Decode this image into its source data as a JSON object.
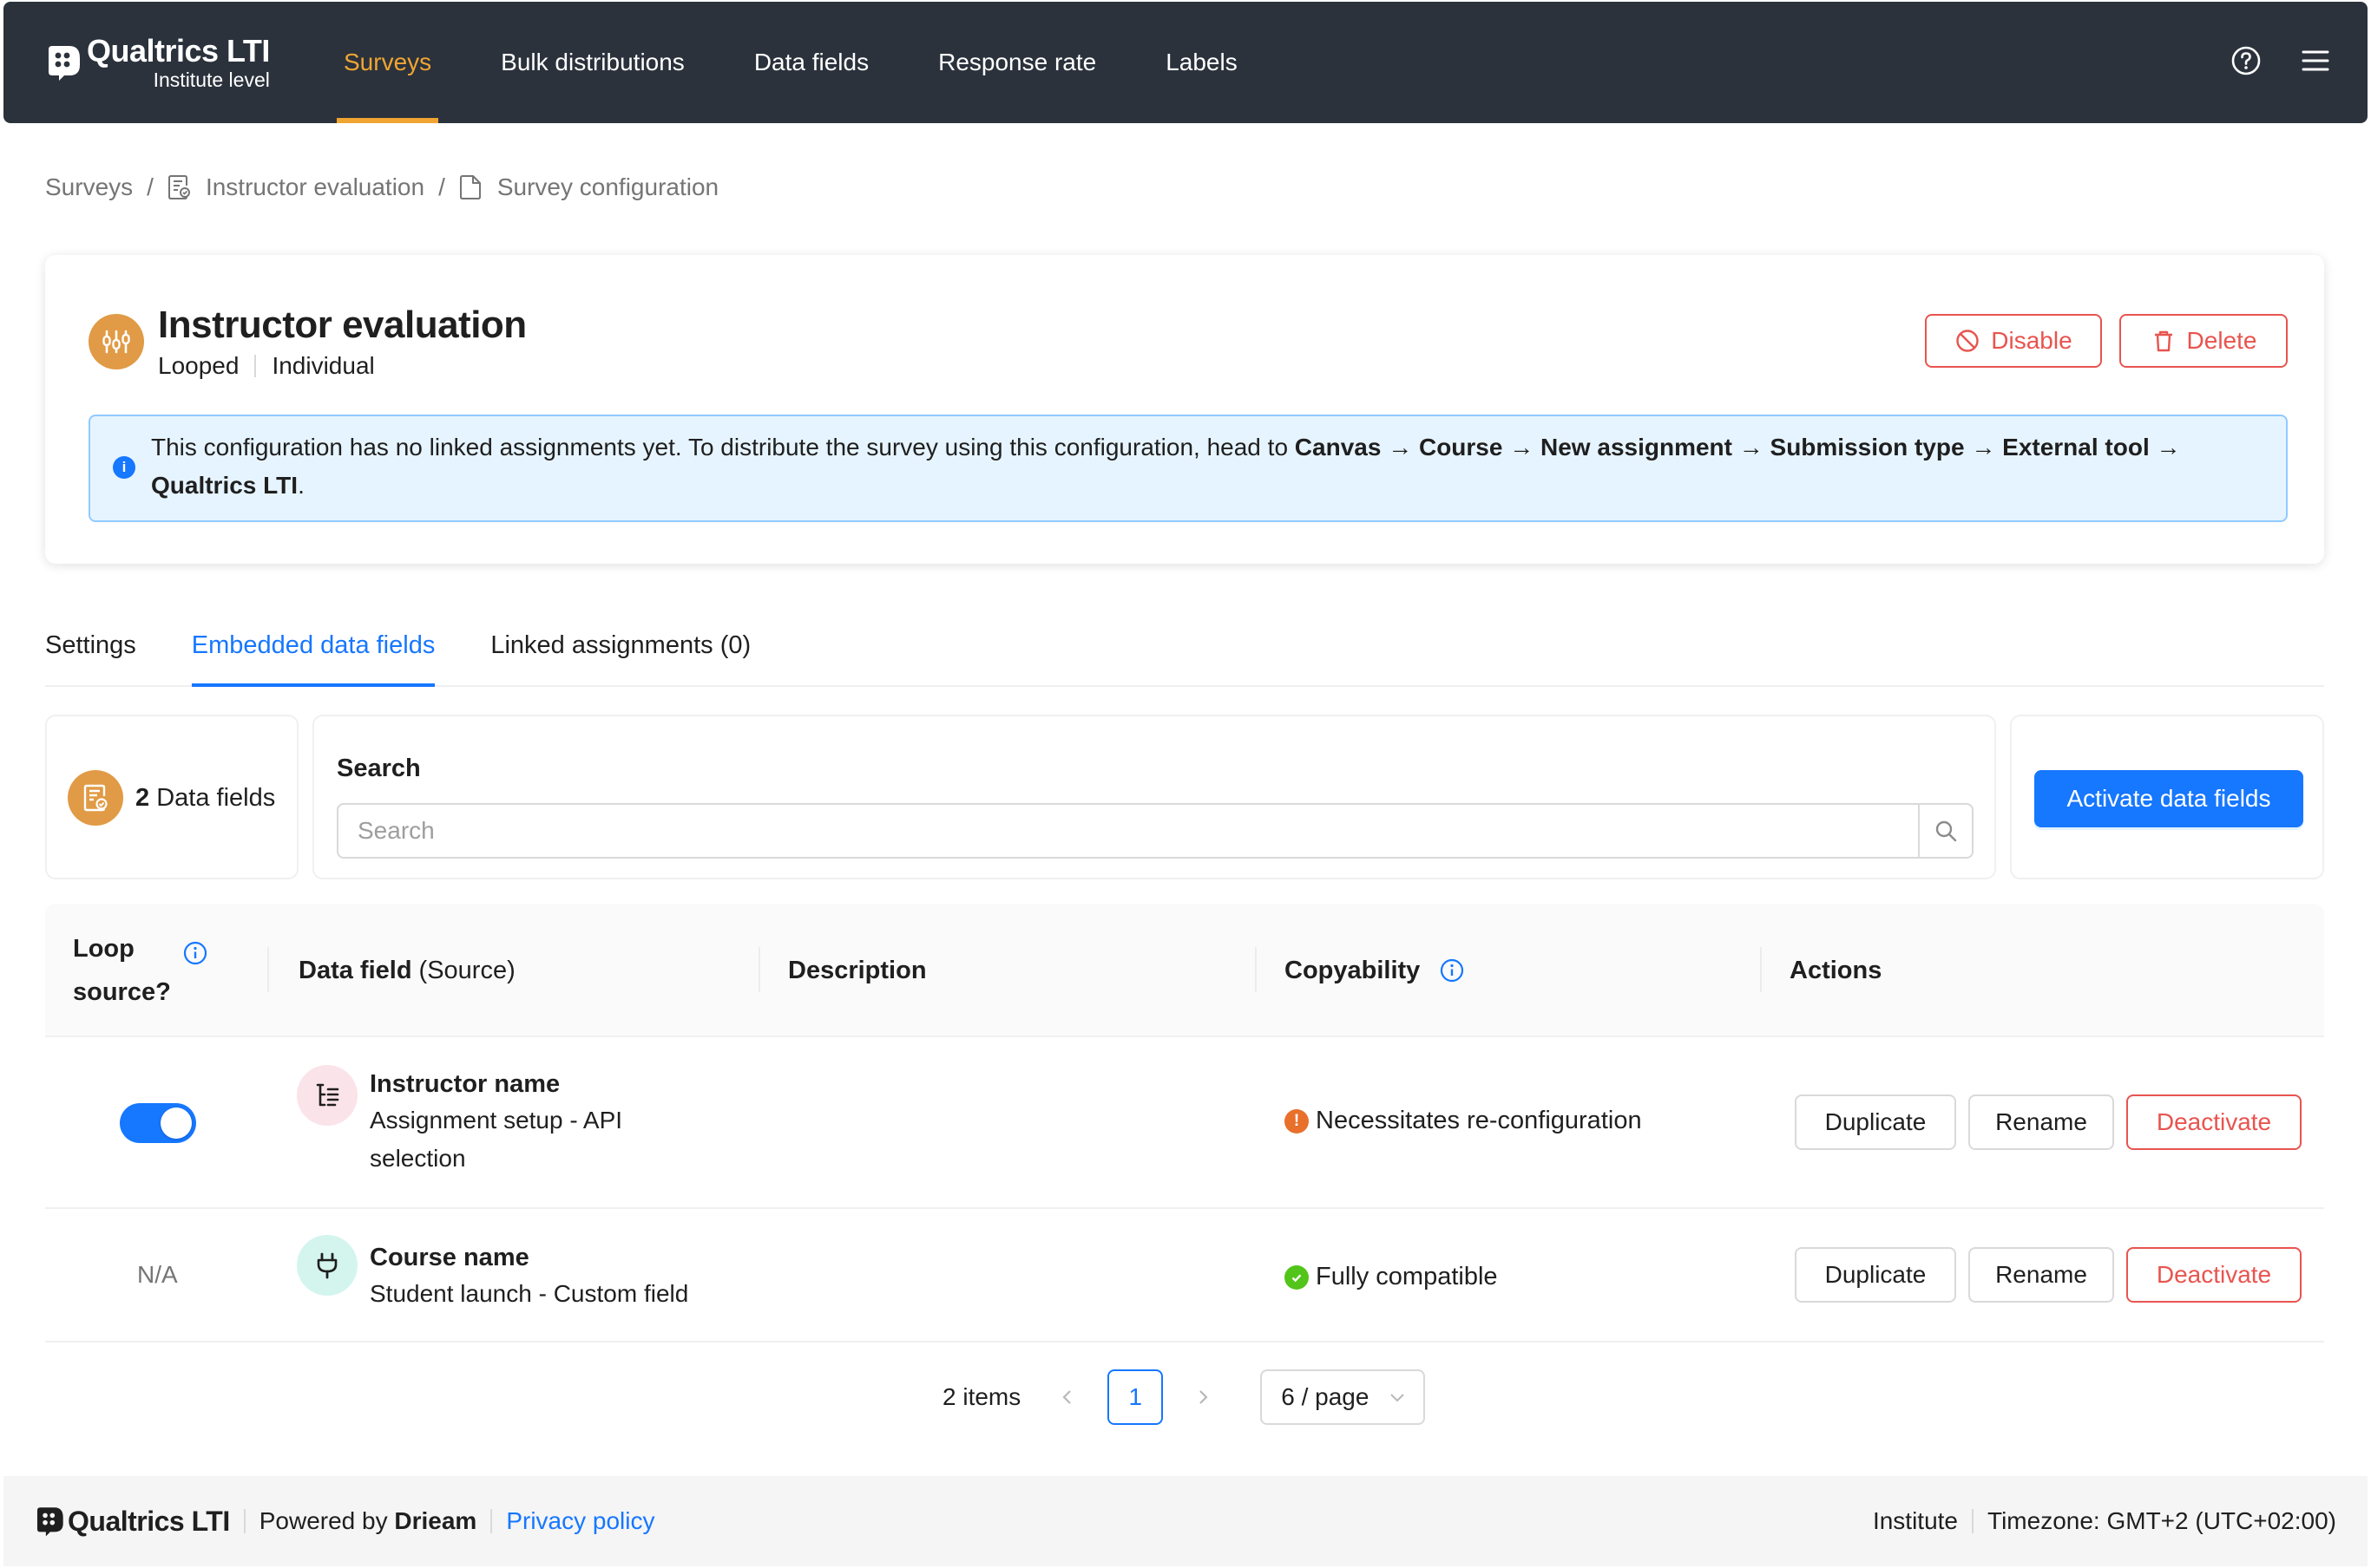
{
  "brand": {
    "name": "Qualtrics LTI",
    "sub": "Institute level"
  },
  "nav": {
    "tabs": [
      "Surveys",
      "Bulk distributions",
      "Data fields",
      "Response rate",
      "Labels"
    ],
    "active_tab": "Surveys"
  },
  "breadcrumb": [
    "Surveys",
    "Instructor evaluation",
    "Survey configuration"
  ],
  "survey": {
    "title": "Instructor evaluation",
    "meta": [
      "Looped",
      "Individual"
    ],
    "disable_label": "Disable",
    "delete_label": "Delete",
    "info": {
      "prefix": "This configuration has no linked assignments yet. To distribute the survey using this configuration, head to",
      "path": [
        "Canvas",
        "Course",
        "New assignment",
        "Submission type",
        "External tool",
        "Qualtrics LTI"
      ],
      "arrow": "→",
      "suffix": "."
    }
  },
  "tabs": [
    "Settings",
    "Embedded data fields",
    "Linked assignments (0)"
  ],
  "active_tab": "Embedded data fields",
  "toolbar": {
    "count": "2",
    "count_label": "Data fields",
    "search_label": "Search",
    "search_placeholder": "Search",
    "activate_label": "Activate data fields"
  },
  "table": {
    "headers": {
      "loop": "Loop source?",
      "field": "Data field",
      "field_sub": "(Source)",
      "description": "Description",
      "copyability": "Copyability",
      "actions": "Actions"
    },
    "rows": [
      {
        "loop_source": true,
        "loop_text": "",
        "name": "Instructor name",
        "source": "Assignment setup - API selection",
        "description": "",
        "copyability": "Necessitates re-configuration",
        "copyability_status": "warning",
        "icon": "list-tree-icon"
      },
      {
        "loop_source": null,
        "loop_text": "N/A",
        "name": "Course name",
        "source": "Student launch - Custom field",
        "description": "",
        "copyability": "Fully compatible",
        "copyability_status": "success",
        "icon": "plug-icon"
      }
    ],
    "actions": {
      "duplicate": "Duplicate",
      "rename": "Rename",
      "deactivate": "Deactivate"
    }
  },
  "pagination": {
    "total": "2 items",
    "current": "1",
    "page_size": "6 / page"
  },
  "footer": {
    "brand": "Qualtrics LTI",
    "powered_prefix": "Powered by",
    "powered_by": "Drieam",
    "privacy": "Privacy policy",
    "role": "Institute",
    "timezone": "Timezone: GMT+2 (UTC+02:00)"
  },
  "colors": {
    "nav_bg": "#2b323c",
    "accent": "#f0a532",
    "primary": "#1677ff",
    "danger": "#e8544f",
    "warning": "#e8702a",
    "success": "#52c41a",
    "icon_orange": "#e19a45",
    "icon_pink": "#fbe3ea",
    "icon_teal": "#d3f5ee"
  }
}
